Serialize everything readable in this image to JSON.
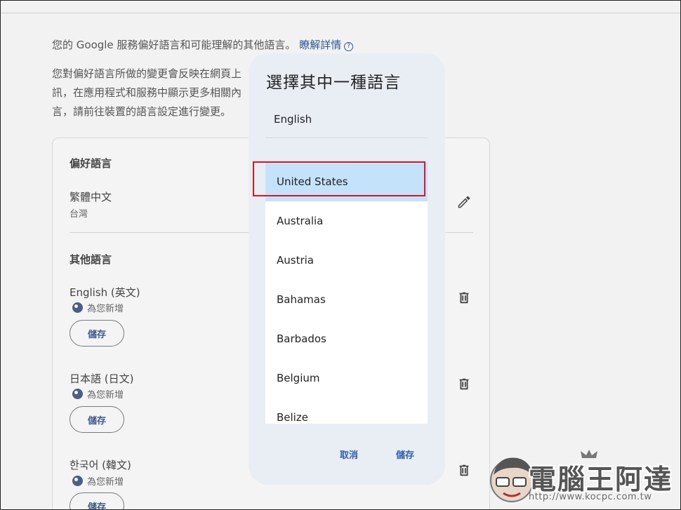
{
  "background": {
    "top_cut_text": "...",
    "intro_text": "您的 Google 服務偏好語言和可能理解的其他語言。",
    "intro_link": "瞭解詳情",
    "intro2_line1": "您對偏好語言所做的變更會反映在網頁上",
    "intro2_line2": "訊，在應用程式和服務中顯示更多相關內",
    "intro2_line3": "言，請前往裝置的語言設定進行變更。",
    "preferred": {
      "title": "偏好語言",
      "language": "繁體中文",
      "region": "台灣"
    },
    "other": {
      "title": "其他語言",
      "items": [
        {
          "name": "English (英文)",
          "note": "為您新增",
          "save": "儲存"
        },
        {
          "name": "日本語 (日文)",
          "note": "為您新增",
          "save": "儲存"
        },
        {
          "name": "한국어 (韓文)",
          "note": "為您新增",
          "save": "儲存"
        }
      ]
    }
  },
  "dialog": {
    "title": "選擇其中一種語言",
    "language": "English",
    "regions": [
      "United States",
      "Australia",
      "Austria",
      "Bahamas",
      "Barbados",
      "Belgium",
      "Belize"
    ],
    "selected": "United States",
    "cancel_label": "取消",
    "save_label": "儲存"
  },
  "watermark": {
    "title": "電腦王阿達",
    "url": "http://www.kocpc.com.tw"
  },
  "colors": {
    "accent": "#2e5fb0",
    "selected_bg": "#c4e2fa",
    "highlight_border": "#e0141e"
  }
}
